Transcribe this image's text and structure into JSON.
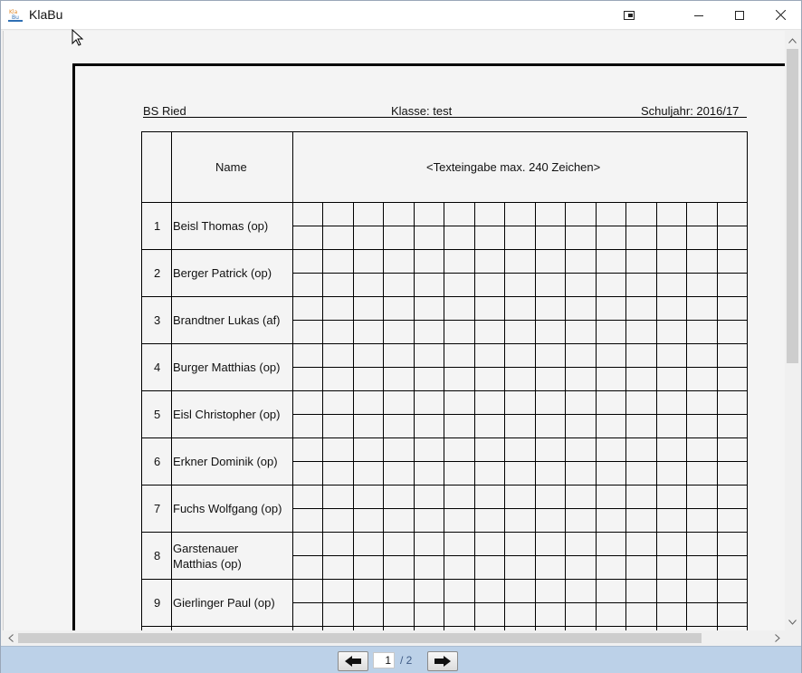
{
  "window": {
    "title": "KlaBu",
    "app_icon": "klabu-logo-icon"
  },
  "document": {
    "school": "BS Ried",
    "class": "Klasse: test",
    "year": "Schuljahr: 2016/17",
    "name_header": "Name",
    "text_header": "<Texteingabe max. 240 Zeichen>",
    "students": [
      {
        "no": "1",
        "name": "Beisl Thomas (op)"
      },
      {
        "no": "2",
        "name": "Berger Patrick (op)"
      },
      {
        "no": "3",
        "name": "Brandtner Lukas (af)"
      },
      {
        "no": "4",
        "name": "Burger Matthias (op)"
      },
      {
        "no": "5",
        "name": "Eisl Christopher (op)"
      },
      {
        "no": "6",
        "name": "Erkner Dominik (op)"
      },
      {
        "no": "7",
        "name": "Fuchs Wolfgang (op)"
      },
      {
        "no": "8",
        "name": "Garstenauer\nMatthias (op)"
      },
      {
        "no": "9",
        "name": "Gierlinger Paul (op)"
      }
    ]
  },
  "navigation": {
    "current_page": "1",
    "total_pages": "/ 2"
  }
}
